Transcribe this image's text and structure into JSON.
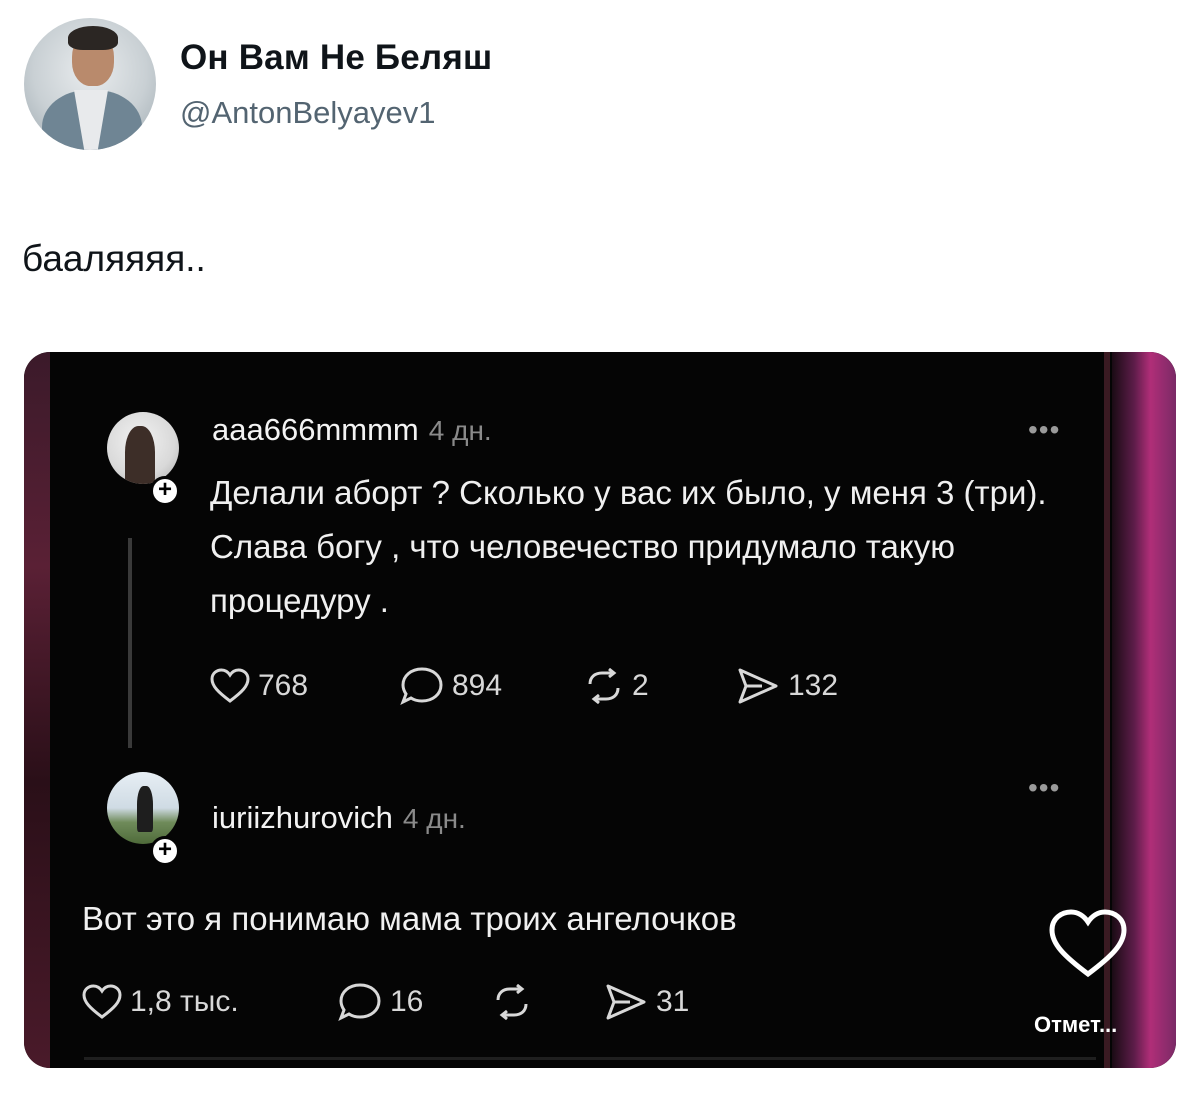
{
  "tweet": {
    "name": "Он Вам Не Беляш",
    "handle": "@AntonBelyayev1",
    "text": "бааляяяя.."
  },
  "screenshot": {
    "comments": [
      {
        "username": "aaa666mmmm",
        "time": "4 дн.",
        "text": "Делали аборт ? Сколько у вас их было, у меня 3 (три). Слава богу , что человечество придумало такую процедуру .",
        "likes": "768",
        "replies": "894",
        "reposts": "2",
        "shares": "132"
      },
      {
        "username": "iuriizhurovich",
        "time": "4 дн.",
        "text": "Вот это я понимаю мама троих ангелочков",
        "likes": "1,8 тыс.",
        "replies": "16",
        "reposts": "",
        "shares": "31"
      }
    ],
    "more_label": "•••",
    "follow_label": "+",
    "side_label": "Отмет..."
  },
  "icons": {
    "heart": "heart-icon",
    "reply": "comment-bubble-icon",
    "repost": "repost-icon",
    "share": "share-send-icon"
  }
}
